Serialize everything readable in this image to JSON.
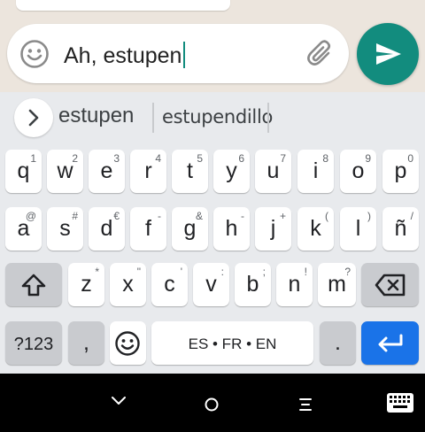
{
  "message_input": {
    "text": "Ah, estupen"
  },
  "suggestions": [
    "estupen",
    "estupendillo"
  ],
  "keyboard": {
    "rows": [
      [
        {
          "key": "q",
          "hint": "1"
        },
        {
          "key": "w",
          "hint": "2"
        },
        {
          "key": "e",
          "hint": "3"
        },
        {
          "key": "r",
          "hint": "4"
        },
        {
          "key": "t",
          "hint": "5"
        },
        {
          "key": "y",
          "hint": "6"
        },
        {
          "key": "u",
          "hint": "7"
        },
        {
          "key": "i",
          "hint": "8"
        },
        {
          "key": "o",
          "hint": "9"
        },
        {
          "key": "p",
          "hint": "0"
        }
      ],
      [
        {
          "key": "a",
          "hint": "@"
        },
        {
          "key": "s",
          "hint": "#"
        },
        {
          "key": "d",
          "hint": "€"
        },
        {
          "key": "f",
          "hint": "-"
        },
        {
          "key": "g",
          "hint": "&"
        },
        {
          "key": "h",
          "hint": "-"
        },
        {
          "key": "j",
          "hint": "+"
        },
        {
          "key": "k",
          "hint": "("
        },
        {
          "key": "l",
          "hint": ")"
        },
        {
          "key": "ñ",
          "hint": "/"
        }
      ],
      [
        {
          "key": "z",
          "hint": "*"
        },
        {
          "key": "x",
          "hint": "\""
        },
        {
          "key": "c",
          "hint": "'"
        },
        {
          "key": "v",
          "hint": ":"
        },
        {
          "key": "b",
          "hint": ";"
        },
        {
          "key": "n",
          "hint": "!"
        },
        {
          "key": "m",
          "hint": "?"
        }
      ]
    ],
    "symbols_label": "?123",
    "comma_label": ",",
    "space_label": "ES • FR • EN",
    "period_label": "."
  },
  "colors": {
    "accent": "#128c7e",
    "enter_key": "#1a73e8"
  },
  "icons": {
    "emoji": "smiley-icon",
    "attach": "paperclip-icon",
    "send": "send-icon",
    "expand_suggestions": "chevron-right-icon",
    "shift": "shift-icon",
    "backspace": "backspace-icon",
    "enter": "enter-icon",
    "nav_back": "chevron-down-icon",
    "nav_home": "home-circle-icon",
    "nav_recents": "recents-icon",
    "nav_keyboard": "keyboard-icon"
  }
}
